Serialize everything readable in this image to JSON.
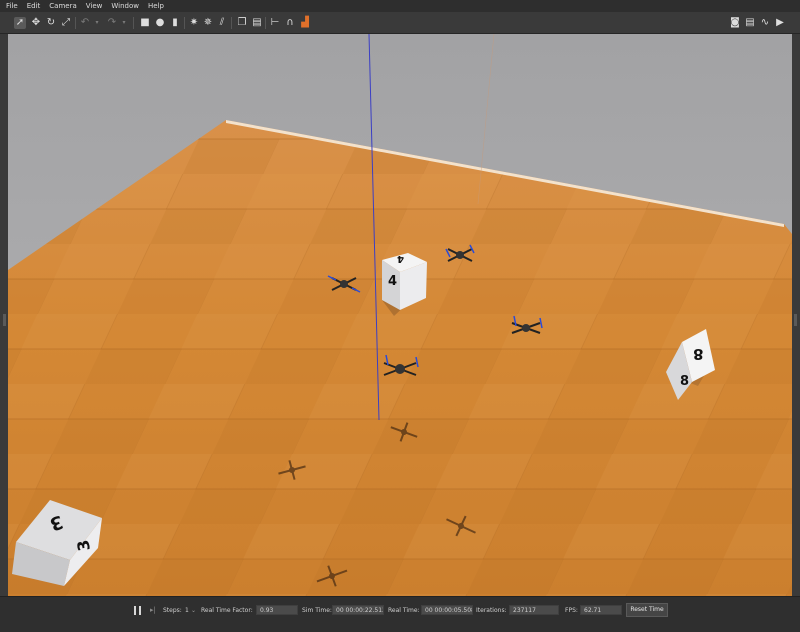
{
  "menu": {
    "items": [
      "File",
      "Edit",
      "Camera",
      "View",
      "Window",
      "Help"
    ]
  },
  "toolbar": {
    "left_icons": [
      "select-mode-icon",
      "translate-mode-icon",
      "rotate-mode-icon",
      "scale-mode-icon",
      "undo-icon",
      "undo-dropdown-icon",
      "redo-icon",
      "redo-dropdown-icon",
      "box-shape-icon",
      "sphere-shape-icon",
      "cylinder-shape-icon",
      "point-light-icon",
      "spot-light-icon",
      "directional-light-icon",
      "copy-icon",
      "paste-icon",
      "align-icon",
      "snap-icon",
      "change-view-icon"
    ],
    "right_icons": [
      "screenshot-icon",
      "log-icon",
      "plot-icon",
      "record-video-icon"
    ]
  },
  "scene": {
    "cube_labels": [
      "4",
      "8",
      "3"
    ],
    "colors": {
      "floor": "#d58a3a",
      "sky": "#a6a6a8",
      "cube": "#f2f2f2",
      "drone_prop": "#2a4bd8"
    }
  },
  "status": {
    "steps_label": "Steps:",
    "steps_value": "1",
    "rtf_label": "Real Time Factor:",
    "rtf_value": "0.93",
    "sim_time_label": "Sim Time:",
    "sim_time_value": "00 00:00:22.513",
    "real_time_label": "Real Time:",
    "real_time_value": "00 00:00:05.508",
    "iterations_label": "Iterations:",
    "iterations_value": "237117",
    "fps_label": "FPS:",
    "fps_value": "62.71",
    "reset_label": "Reset Time"
  }
}
